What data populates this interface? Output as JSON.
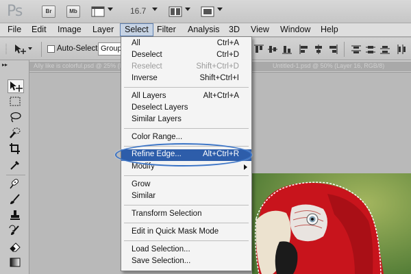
{
  "appbar": {
    "logo": "Ps",
    "bridge_chip": "Br",
    "minibridge_chip": "Mb",
    "zoom": "16.7"
  },
  "menubar": {
    "items": [
      "File",
      "Edit",
      "Image",
      "Layer",
      "Select",
      "Filter",
      "Analysis",
      "3D",
      "View",
      "Window",
      "Help"
    ],
    "active": "Select"
  },
  "options": {
    "auto_select_label": "Auto-Select:",
    "auto_select_value": "Group"
  },
  "tabs": {
    "doc1": "Ally like is colorful.psd @ 25% (Layer 1, RGB/8)",
    "doc2": "Untitled-1.psd @ 50% (Layer 16, RGB/8)"
  },
  "select_menu": {
    "items": [
      {
        "label": "All",
        "shortcut": "Ctrl+A"
      },
      {
        "label": "Deselect",
        "shortcut": "Ctrl+D"
      },
      {
        "label": "Reselect",
        "shortcut": "Shift+Ctrl+D",
        "disabled": true
      },
      {
        "label": "Inverse",
        "shortcut": "Shift+Ctrl+I"
      },
      {
        "label": "All Layers",
        "shortcut": "Alt+Ctrl+A"
      },
      {
        "label": "Deselect Layers",
        "shortcut": ""
      },
      {
        "label": "Similar Layers",
        "shortcut": ""
      },
      {
        "label": "Color Range...",
        "shortcut": ""
      },
      {
        "label": "Refine Edge...",
        "shortcut": "Alt+Ctrl+R",
        "highlighted": true
      },
      {
        "label": "Modify",
        "shortcut": "",
        "submenu": true
      },
      {
        "label": "Grow",
        "shortcut": ""
      },
      {
        "label": "Similar",
        "shortcut": ""
      },
      {
        "label": "Transform Selection",
        "shortcut": ""
      },
      {
        "label": "Edit in Quick Mask Mode",
        "shortcut": ""
      },
      {
        "label": "Load Selection...",
        "shortcut": ""
      },
      {
        "label": "Save Selection...",
        "shortcut": ""
      }
    ]
  },
  "colors": {
    "menu_highlight": "#2d5daa",
    "callout_ring": "#3a73c4",
    "parrot_red": "#c8141c"
  }
}
